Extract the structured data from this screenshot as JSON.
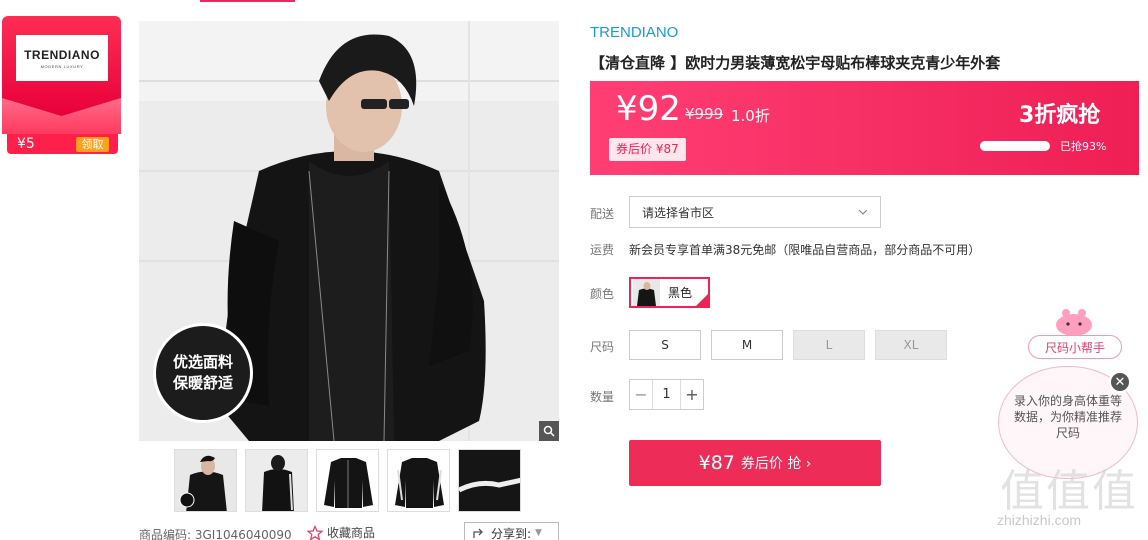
{
  "brand_card": {
    "logo_name": "TRENDIANO",
    "logo_sub": "MODERN LUXURY",
    "coupon_amount": "¥5",
    "claim_label": "领取"
  },
  "main_image": {
    "badge_line1": "优选面料",
    "badge_line2": "保暖舒适",
    "zoom_icon": "magnifier-icon"
  },
  "meta": {
    "code_label": "商品编码:",
    "code_value": "3GI1046040090",
    "favorite_label": "收藏商品",
    "share_label": "分享到:"
  },
  "product": {
    "brand": "TRENDIANO",
    "title": "【清仓直降 】欧时力男装薄宽松宇母贴布棒球夹克青少年外套"
  },
  "price": {
    "current": "¥92",
    "original": "¥999",
    "discount": "1.0折",
    "coupon_price": "券后价 ¥87",
    "flash_label": "3折疯抢",
    "sold_percent": 93,
    "sold_text": "已抢93%"
  },
  "options": {
    "delivery_label": "配送",
    "region_placeholder": "请选择省市区",
    "shipping_label": "运费",
    "shipping_text": "新会员专享首单满38元免邮（限唯品自营商品，部分商品不可用）",
    "color_label": "颜色",
    "color_value": "黑色",
    "size_label": "尺码",
    "sizes": [
      "S",
      "M",
      "L",
      "XL"
    ],
    "qty_label": "数量",
    "qty_value": "1",
    "qty_minus": "−",
    "qty_plus": "+"
  },
  "buy": {
    "amount": "¥87",
    "text": "券后价 抢 ›"
  },
  "helper": {
    "tag": "尺码小帮手",
    "text": "录入你的身高体重等数据，为你精准推荐尺码",
    "close": "✕"
  },
  "watermark": {
    "site": "zhizhizhi.com",
    "glyph": "值值值"
  },
  "colors": {
    "accent": "#ee2459",
    "brand_blue": "#1a9ad7"
  }
}
